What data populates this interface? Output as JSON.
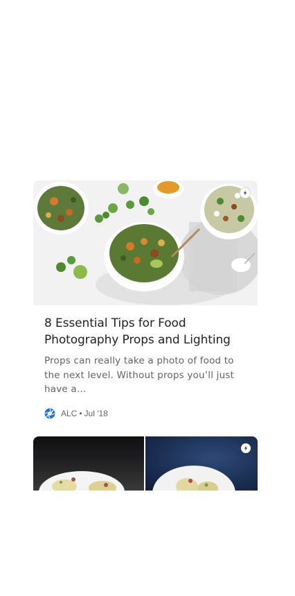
{
  "card1": {
    "title": "8 Essential Tips for Food Photography Props and Lighting",
    "snippet": "Props can really take a photo of food to the next level. Without props you’ll just have a…",
    "source": "ALC",
    "separator": "•",
    "date": "Jul '18",
    "amp_icon": "lightning-bolt-icon",
    "source_icon": "camera-aperture-icon",
    "accent_color": "#1a73e8"
  },
  "card2": {
    "amp_icon": "lightning-bolt-icon"
  }
}
